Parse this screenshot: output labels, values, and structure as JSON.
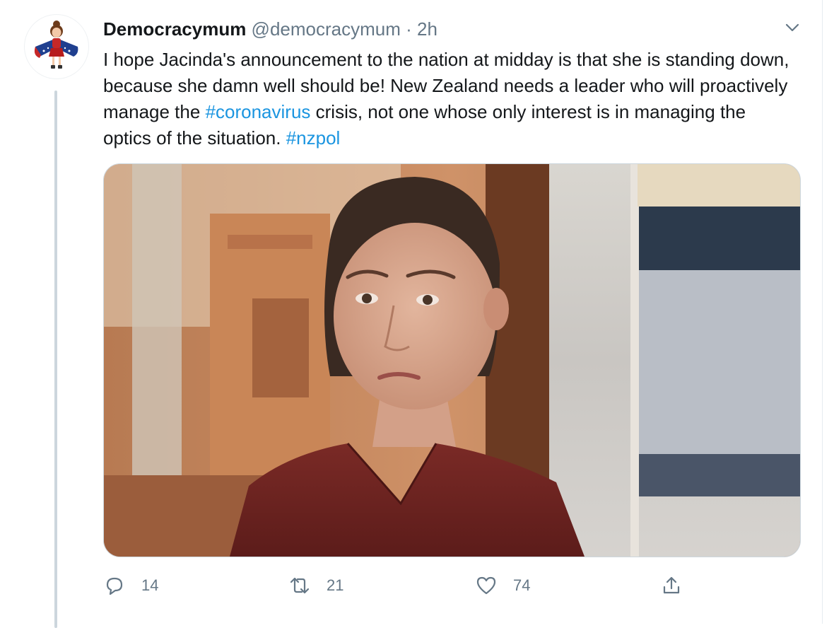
{
  "tweet": {
    "display_name": "Democracymum",
    "handle": "@democracymum",
    "separator": "·",
    "time": "2h",
    "text": {
      "part1": "I hope Jacinda's announcement to the nation at midday is that she is standing down, because she damn well should be!  New Zealand needs a leader who will proactively manage the ",
      "hashtag1": "#coronavirus",
      "part2": " crisis, not one whose only interest is in managing the optics of the situation. ",
      "hashtag2": "#nzpol"
    },
    "actions": {
      "replies": "14",
      "retweets": "21",
      "likes": "74"
    }
  },
  "icons": {
    "menu": "chevron-down-icon",
    "reply": "reply-icon",
    "retweet": "retweet-icon",
    "like": "heart-icon",
    "share": "share-icon"
  },
  "colors": {
    "link": "#1b95e0",
    "text": "#14171a",
    "muted": "#657786"
  }
}
